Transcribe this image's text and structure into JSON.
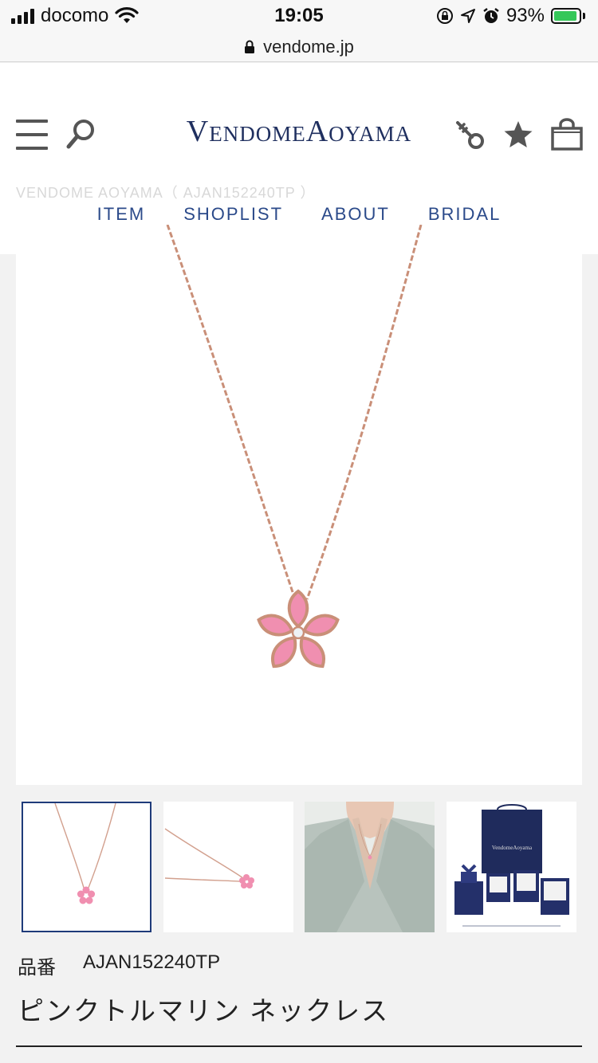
{
  "status_bar": {
    "carrier": "docomo",
    "time": "19:05",
    "battery_percent": "93%",
    "battery_level": 0.93,
    "icons": [
      "signal-icon",
      "wifi-icon",
      "orientation-lock-icon",
      "location-icon",
      "alarm-icon",
      "battery-charging-icon"
    ]
  },
  "browser": {
    "url": "vendome.jp",
    "lock_icon": "lock-icon"
  },
  "header": {
    "logo": "VendomeAoyama",
    "breadcrumb": "VENDOME AOYAMA（ AJAN152240TP ）",
    "icons": [
      "menu-icon",
      "search-icon",
      "key-icon",
      "star-icon",
      "shopping-bag-icon"
    ],
    "nav": [
      {
        "label": "ITEM"
      },
      {
        "label": "SHOPLIST"
      },
      {
        "label": "ABOUT"
      },
      {
        "label": "BRIDAL"
      }
    ]
  },
  "product": {
    "code_label": "品番",
    "code_value": "AJAN152240TP",
    "name": "ピンクトルマリン ネックレス",
    "thumbnail_logo": "VendomeAoyama"
  },
  "colors": {
    "brand_navy": "#1f2f5f",
    "nav_blue": "#2b4a8a",
    "rose_gold": "#c98f78",
    "tourmaline_pink": "#f08fb0",
    "thumb_active_border": "#1f3b7a"
  }
}
